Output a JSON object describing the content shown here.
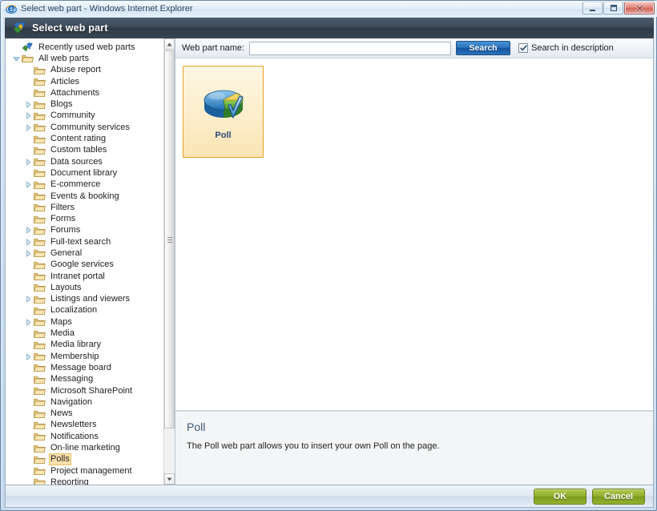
{
  "window": {
    "title": "Select web part - Windows Internet Explorer",
    "app_icon": "internet-explorer-icon",
    "controls": {
      "minimize": "Minimize",
      "maximize": "Maximize",
      "close": "Close"
    }
  },
  "dialog": {
    "icon": "web-part-puzzle-icon",
    "title": "Select web part"
  },
  "search": {
    "label": "Web part name:",
    "value": "",
    "placeholder": "",
    "button_label": "Search",
    "checkbox_label": "Search in description",
    "checkbox_checked": true
  },
  "tree": {
    "items": [
      {
        "label": "Recently used web parts",
        "indent": 0,
        "twisty": "none",
        "icon": "recent-webparts-icon",
        "selected": false
      },
      {
        "label": "All web parts",
        "indent": 0,
        "twisty": "expanded",
        "icon": "folder-icon",
        "selected": false
      },
      {
        "label": "Abuse report",
        "indent": 1,
        "twisty": "none",
        "icon": "folder-icon",
        "selected": false
      },
      {
        "label": "Articles",
        "indent": 1,
        "twisty": "none",
        "icon": "folder-icon",
        "selected": false
      },
      {
        "label": "Attachments",
        "indent": 1,
        "twisty": "none",
        "icon": "folder-icon",
        "selected": false
      },
      {
        "label": "Blogs",
        "indent": 1,
        "twisty": "collapsed",
        "icon": "folder-icon",
        "selected": false
      },
      {
        "label": "Community",
        "indent": 1,
        "twisty": "collapsed",
        "icon": "folder-icon",
        "selected": false
      },
      {
        "label": "Community services",
        "indent": 1,
        "twisty": "collapsed",
        "icon": "folder-icon",
        "selected": false
      },
      {
        "label": "Content rating",
        "indent": 1,
        "twisty": "none",
        "icon": "folder-icon",
        "selected": false
      },
      {
        "label": "Custom tables",
        "indent": 1,
        "twisty": "none",
        "icon": "folder-icon",
        "selected": false
      },
      {
        "label": "Data sources",
        "indent": 1,
        "twisty": "collapsed",
        "icon": "folder-icon",
        "selected": false
      },
      {
        "label": "Document library",
        "indent": 1,
        "twisty": "none",
        "icon": "folder-icon",
        "selected": false
      },
      {
        "label": "E-commerce",
        "indent": 1,
        "twisty": "collapsed",
        "icon": "folder-icon",
        "selected": false
      },
      {
        "label": "Events & booking",
        "indent": 1,
        "twisty": "none",
        "icon": "folder-icon",
        "selected": false
      },
      {
        "label": "Filters",
        "indent": 1,
        "twisty": "none",
        "icon": "folder-icon",
        "selected": false
      },
      {
        "label": "Forms",
        "indent": 1,
        "twisty": "none",
        "icon": "folder-icon",
        "selected": false
      },
      {
        "label": "Forums",
        "indent": 1,
        "twisty": "collapsed",
        "icon": "folder-icon",
        "selected": false
      },
      {
        "label": "Full-text search",
        "indent": 1,
        "twisty": "collapsed",
        "icon": "folder-icon",
        "selected": false
      },
      {
        "label": "General",
        "indent": 1,
        "twisty": "collapsed",
        "icon": "folder-icon",
        "selected": false
      },
      {
        "label": "Google services",
        "indent": 1,
        "twisty": "none",
        "icon": "folder-icon",
        "selected": false
      },
      {
        "label": "Intranet portal",
        "indent": 1,
        "twisty": "none",
        "icon": "folder-icon",
        "selected": false
      },
      {
        "label": "Layouts",
        "indent": 1,
        "twisty": "none",
        "icon": "folder-icon",
        "selected": false
      },
      {
        "label": "Listings and viewers",
        "indent": 1,
        "twisty": "collapsed",
        "icon": "folder-icon",
        "selected": false
      },
      {
        "label": "Localization",
        "indent": 1,
        "twisty": "none",
        "icon": "folder-icon",
        "selected": false
      },
      {
        "label": "Maps",
        "indent": 1,
        "twisty": "collapsed",
        "icon": "folder-icon",
        "selected": false
      },
      {
        "label": "Media",
        "indent": 1,
        "twisty": "none",
        "icon": "folder-icon",
        "selected": false
      },
      {
        "label": "Media library",
        "indent": 1,
        "twisty": "none",
        "icon": "folder-icon",
        "selected": false
      },
      {
        "label": "Membership",
        "indent": 1,
        "twisty": "collapsed",
        "icon": "folder-icon",
        "selected": false
      },
      {
        "label": "Message board",
        "indent": 1,
        "twisty": "none",
        "icon": "folder-icon",
        "selected": false
      },
      {
        "label": "Messaging",
        "indent": 1,
        "twisty": "none",
        "icon": "folder-icon",
        "selected": false
      },
      {
        "label": "Microsoft SharePoint",
        "indent": 1,
        "twisty": "none",
        "icon": "folder-icon",
        "selected": false
      },
      {
        "label": "Navigation",
        "indent": 1,
        "twisty": "none",
        "icon": "folder-icon",
        "selected": false
      },
      {
        "label": "News",
        "indent": 1,
        "twisty": "none",
        "icon": "folder-icon",
        "selected": false
      },
      {
        "label": "Newsletters",
        "indent": 1,
        "twisty": "none",
        "icon": "folder-icon",
        "selected": false
      },
      {
        "label": "Notifications",
        "indent": 1,
        "twisty": "none",
        "icon": "folder-icon",
        "selected": false
      },
      {
        "label": "On-line marketing",
        "indent": 1,
        "twisty": "none",
        "icon": "folder-icon",
        "selected": false
      },
      {
        "label": "Polls",
        "indent": 1,
        "twisty": "none",
        "icon": "folder-icon",
        "selected": true
      },
      {
        "label": "Project management",
        "indent": 1,
        "twisty": "none",
        "icon": "folder-icon",
        "selected": false
      },
      {
        "label": "Reporting",
        "indent": 1,
        "twisty": "none",
        "icon": "folder-icon",
        "selected": false
      }
    ]
  },
  "gallery": {
    "items": [
      {
        "label": "Poll",
        "icon": "poll-piechart-check-icon",
        "selected": true
      }
    ]
  },
  "detail": {
    "title": "Poll",
    "description": "The Poll web part allows you to insert your own Poll on the page."
  },
  "footer": {
    "ok_label": "OK",
    "cancel_label": "Cancel"
  },
  "colors": {
    "header_dark": "#39454f",
    "accent_blue": "#14559e",
    "button_green": "#7a9a1b",
    "tile_border": "#e3a428",
    "selection": "#fbdfa8"
  }
}
